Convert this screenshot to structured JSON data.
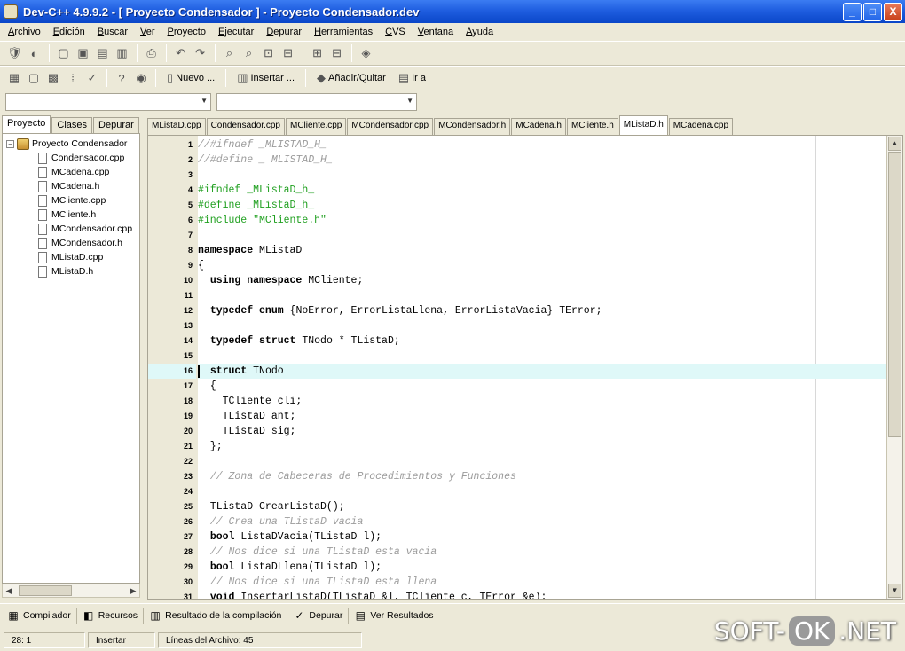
{
  "window": {
    "title": "Dev-C++ 4.9.9.2  - [ Proyecto Condensador ] - Proyecto Condensador.dev",
    "minimize": "_",
    "maximize": "□",
    "close": "X"
  },
  "menu": [
    "Archivo",
    "Edición",
    "Buscar",
    "Ver",
    "Proyecto",
    "Ejecutar",
    "Depurar",
    "Herramientas",
    "CVS",
    "Ventana",
    "Ayuda"
  ],
  "toolbar2": {
    "nuevo": "Nuevo ...",
    "insertar": "Insertar ...",
    "anadir_quitar": "Añadir/Quitar",
    "ir_a": "Ir a"
  },
  "left_tabs": [
    "Proyecto",
    "Clases",
    "Depurar"
  ],
  "tree": {
    "root": "Proyecto Condensador",
    "expander": "−",
    "files": [
      "Condensador.cpp",
      "MCadena.cpp",
      "MCadena.h",
      "MCliente.cpp",
      "MCliente.h",
      "MCondensador.cpp",
      "MCondensador.h",
      "MListaD.cpp",
      "MListaD.h"
    ]
  },
  "file_tabs": [
    "MListaD.cpp",
    "Condensador.cpp",
    "MCliente.cpp",
    "MCondensador.cpp",
    "MCondensador.h",
    "MCadena.h",
    "MCliente.h",
    "MListaD.h",
    "MCadena.cpp"
  ],
  "active_file_tab": 7,
  "code": {
    "highlight_line": 16,
    "lines": [
      {
        "n": "1",
        "parts": [
          [
            "c",
            "//#ifndef _MLISTAD_H_"
          ]
        ]
      },
      {
        "n": "2",
        "parts": [
          [
            "c",
            "//#define _ MLISTAD_H_"
          ]
        ]
      },
      {
        "n": "3",
        "parts": []
      },
      {
        "n": "4",
        "parts": [
          [
            "p",
            "#ifndef _MListaD_h_"
          ]
        ]
      },
      {
        "n": "5",
        "parts": [
          [
            "p",
            "#define _MListaD_h_"
          ]
        ]
      },
      {
        "n": "6",
        "parts": [
          [
            "p",
            "#include \"MCliente.h\""
          ]
        ]
      },
      {
        "n": "7",
        "parts": []
      },
      {
        "n": "8",
        "parts": [
          [
            "k",
            "namespace"
          ],
          [
            "n",
            " MListaD"
          ]
        ]
      },
      {
        "n": "9",
        "parts": [
          [
            "n",
            "{"
          ]
        ]
      },
      {
        "n": "10",
        "parts": [
          [
            "n",
            "  "
          ],
          [
            "k",
            "using namespace"
          ],
          [
            "n",
            " MCliente;"
          ]
        ]
      },
      {
        "n": "11",
        "parts": []
      },
      {
        "n": "12",
        "parts": [
          [
            "n",
            "  "
          ],
          [
            "k",
            "typedef enum"
          ],
          [
            "n",
            " {NoError, ErrorListaLlena, ErrorListaVacia} TError;"
          ]
        ]
      },
      {
        "n": "13",
        "parts": []
      },
      {
        "n": "14",
        "parts": [
          [
            "n",
            "  "
          ],
          [
            "k",
            "typedef struct"
          ],
          [
            "n",
            " TNodo * TListaD;"
          ]
        ]
      },
      {
        "n": "15",
        "parts": []
      },
      {
        "n": "16",
        "parts": [
          [
            "n",
            "  "
          ],
          [
            "k",
            "struct"
          ],
          [
            "n",
            " TNodo"
          ]
        ]
      },
      {
        "n": "17",
        "parts": [
          [
            "n",
            "  {"
          ]
        ]
      },
      {
        "n": "18",
        "parts": [
          [
            "n",
            "    TCliente cli;"
          ]
        ]
      },
      {
        "n": "19",
        "parts": [
          [
            "n",
            "    TListaD ant;"
          ]
        ]
      },
      {
        "n": "20",
        "parts": [
          [
            "n",
            "    TListaD sig;"
          ]
        ]
      },
      {
        "n": "21",
        "parts": [
          [
            "n",
            "  };"
          ]
        ]
      },
      {
        "n": "22",
        "parts": []
      },
      {
        "n": "23",
        "parts": [
          [
            "n",
            "  "
          ],
          [
            "c",
            "// Zona de Cabeceras de Procedimientos y Funciones"
          ]
        ]
      },
      {
        "n": "24",
        "parts": []
      },
      {
        "n": "25",
        "parts": [
          [
            "n",
            "  TListaD CrearListaD();"
          ]
        ]
      },
      {
        "n": "26",
        "parts": [
          [
            "n",
            "  "
          ],
          [
            "c",
            "// Crea una TListaD vacia"
          ]
        ]
      },
      {
        "n": "27",
        "parts": [
          [
            "n",
            "  "
          ],
          [
            "k",
            "bool"
          ],
          [
            "n",
            " ListaDVacia(TListaD l);"
          ]
        ]
      },
      {
        "n": "28",
        "parts": [
          [
            "n",
            "  "
          ],
          [
            "c",
            "// Nos dice si una TListaD esta vacia"
          ]
        ]
      },
      {
        "n": "29",
        "parts": [
          [
            "n",
            "  "
          ],
          [
            "k",
            "bool"
          ],
          [
            "n",
            " ListaDLlena(TListaD l);"
          ]
        ]
      },
      {
        "n": "30",
        "parts": [
          [
            "n",
            "  "
          ],
          [
            "c",
            "// Nos dice si una TListaD esta llena"
          ]
        ]
      },
      {
        "n": "31",
        "parts": [
          [
            "n",
            "  "
          ],
          [
            "k",
            "void"
          ],
          [
            "n",
            " InsertarListaD(TListaD &l, TCliente c, TError &e);"
          ]
        ]
      }
    ]
  },
  "bottom_tabs": [
    {
      "icon": "▦",
      "label": "Compilador"
    },
    {
      "icon": "◧",
      "label": "Recursos"
    },
    {
      "icon": "▥",
      "label": "Resultado de la compilación"
    },
    {
      "icon": "✓",
      "label": "Depurar"
    },
    {
      "icon": "▤",
      "label": "Ver Resultados"
    }
  ],
  "status": {
    "position": "28: 1",
    "mode": "Insertar",
    "lines": "Líneas del Archivo: 45"
  },
  "watermark": {
    "left": "SOFT-",
    "ok": "OK",
    "right": ".NET"
  }
}
